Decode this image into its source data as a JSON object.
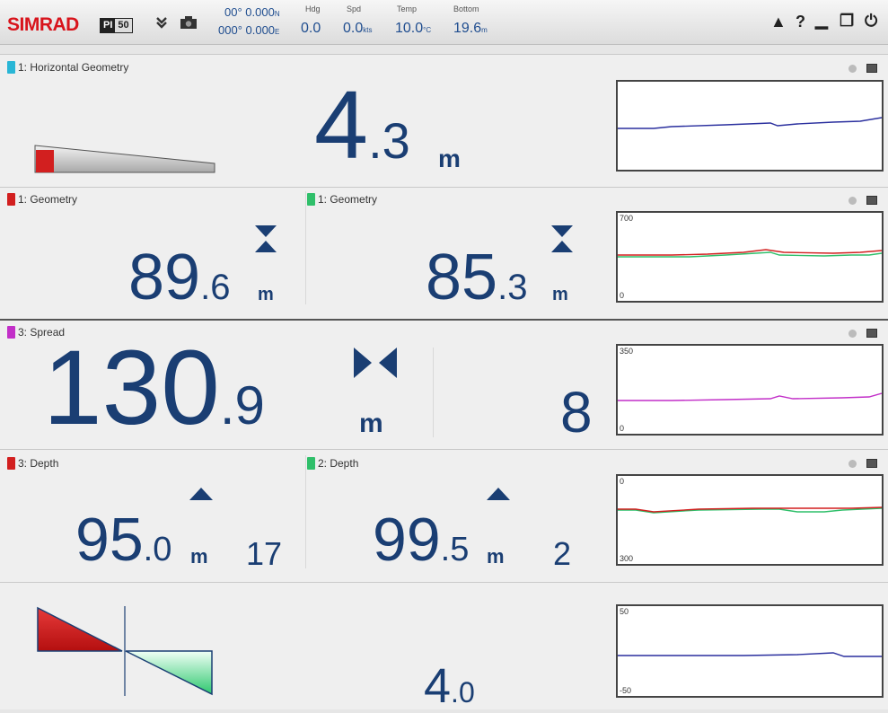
{
  "topbar": {
    "logo": "SIMRAD",
    "model_a": "PI",
    "model_b": "50",
    "lat": "00° 0.000",
    "lat_hemi": "N",
    "lon": "000° 0.000",
    "lon_hemi": "E",
    "hdg_label": "Hdg",
    "hdg_value": "0.0",
    "spd_label": "Spd",
    "spd_value": "0.0",
    "spd_unit": "kts",
    "temp_label": "Temp",
    "temp_value": "10.0",
    "temp_unit": "°C",
    "bottom_label": "Bottom",
    "bottom_value": "19.6",
    "bottom_unit": "m",
    "alarm_glyph": "▲",
    "help_glyph": "?",
    "minimize_glyph": "▁",
    "window_glyph": "❐",
    "power_glyph": "⏻"
  },
  "panels": {
    "hgeom": {
      "title": "1: Horizontal Geometry",
      "swatch": "#29b6d6",
      "int": "4",
      "dec": ".3",
      "unit": "m"
    },
    "geom1": {
      "title": "1: Geometry",
      "swatch": "#d21f1f",
      "int": "89",
      "dec": ".6",
      "unit": "m"
    },
    "geom2": {
      "title": "1: Geometry",
      "swatch": "#2fbf6a",
      "int": "85",
      "dec": ".3",
      "unit": "m",
      "plot_top": "700",
      "plot_bottom": "0"
    },
    "spread": {
      "title": "3: Spread",
      "swatch": "#c22fc8",
      "int": "130",
      "dec": ".9",
      "unit": "m",
      "count": "8",
      "plot_top": "350",
      "plot_bottom": "0"
    },
    "depth3": {
      "title": "3: Depth",
      "swatch": "#d21f1f",
      "int": "95",
      "dec": ".0",
      "unit": "m",
      "count": "17"
    },
    "depth2": {
      "title": "2: Depth",
      "swatch": "#2fbf6a",
      "int": "99",
      "dec": ".5",
      "unit": "m",
      "count": "2",
      "plot_top": "0",
      "plot_bottom": "300"
    },
    "roll": {
      "int": "4",
      "dec": ".0",
      "plot_top": "50",
      "plot_bottom": "-50"
    }
  },
  "colors": {
    "value": "#1a3e73",
    "red": "#d21f1f",
    "green": "#2fbf6a",
    "magenta": "#c22fc8",
    "blue": "#2a2f9e"
  }
}
